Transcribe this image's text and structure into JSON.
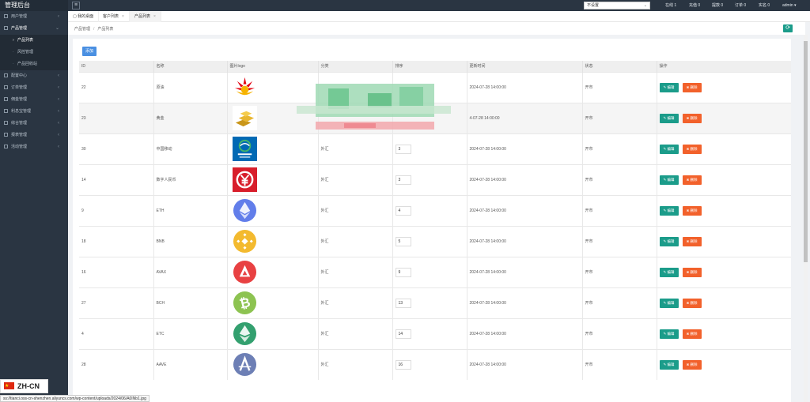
{
  "brand": "管理后台",
  "sidebar": {
    "items": [
      {
        "label": "用户管理",
        "chevron": "‹",
        "open": false
      },
      {
        "label": "产品管理",
        "chevron": "⌄",
        "open": true
      },
      {
        "label": "产品列表",
        "sub": true,
        "active": true
      },
      {
        "label": "风控管理",
        "sub": true
      },
      {
        "label": "产品回收站",
        "sub": true
      },
      {
        "label": "配置中心",
        "chevron": "‹"
      },
      {
        "label": "订单管理",
        "chevron": "‹"
      },
      {
        "label": "佣金管理",
        "chevron": "‹"
      },
      {
        "label": "利息宝管理",
        "chevron": "‹"
      },
      {
        "label": "综合管理",
        "chevron": "‹"
      },
      {
        "label": "报表管理",
        "chevron": "‹"
      },
      {
        "label": "活动管理",
        "chevron": "‹"
      }
    ]
  },
  "topbar": {
    "menu_icon": "≡",
    "select_value": "不设置",
    "stats": [
      {
        "label": "在线 1"
      },
      {
        "label": "充值 0"
      },
      {
        "label": "提款 0"
      },
      {
        "label": "订单 0"
      },
      {
        "label": "实名 0"
      },
      {
        "label": "admin ▾"
      }
    ]
  },
  "tabs": [
    {
      "label": "我的桌面",
      "icon": "▢",
      "closable": false
    },
    {
      "label": "客户列表",
      "closable": true
    },
    {
      "label": "产品列表",
      "closable": true,
      "active": true
    }
  ],
  "breadcrumb": {
    "items": [
      "产品管理",
      "产品列表"
    ],
    "separator": "/"
  },
  "refresh_icon": "⟳",
  "add_button": "添加",
  "table": {
    "headers": [
      "ID",
      "名称",
      "图片logo",
      "分类",
      "排序",
      "更新时间",
      "状态",
      "操作"
    ],
    "rows": [
      {
        "id": "22",
        "name": "原油",
        "logo": "oil",
        "category": "",
        "sort": "",
        "time": "2024-07-28 14:00:00",
        "status": "开市"
      },
      {
        "id": "23",
        "name": "黄金",
        "logo": "gold",
        "category": "",
        "sort": "",
        "time": "4-07-28 14:00:00",
        "status": "开市"
      },
      {
        "id": "30",
        "name": "中国移动",
        "logo": "mobile",
        "category": "外汇",
        "sort": "3",
        "time": "2024-07-28 14:00:00",
        "status": "开市"
      },
      {
        "id": "14",
        "name": "数字人民币",
        "logo": "ecny",
        "category": "外汇",
        "sort": "3",
        "time": "2024-07-28 14:00:00",
        "status": "开市"
      },
      {
        "id": "9",
        "name": "ETH",
        "logo": "eth",
        "category": "外汇",
        "sort": "4",
        "time": "2024-07-28 14:00:00",
        "status": "开市"
      },
      {
        "id": "18",
        "name": "BNB",
        "logo": "bnb",
        "category": "外汇",
        "sort": "5",
        "time": "2024-07-28 14:00:00",
        "status": "开市"
      },
      {
        "id": "16",
        "name": "AVAX",
        "logo": "avax",
        "category": "外汇",
        "sort": "9",
        "time": "2024-07-28 14:00:00",
        "status": "开市"
      },
      {
        "id": "27",
        "name": "BCH",
        "logo": "bch",
        "category": "外汇",
        "sort": "13",
        "time": "2024-07-28 14:00:00",
        "status": "开市"
      },
      {
        "id": "4",
        "name": "ETC",
        "logo": "etc",
        "category": "外汇",
        "sort": "14",
        "time": "2024-07-28 14:00:00",
        "status": "开市"
      },
      {
        "id": "28",
        "name": "AAVE",
        "logo": "aave",
        "category": "外汇",
        "sort": "16",
        "time": "2024-07-28 14:00:00",
        "status": "开市"
      }
    ],
    "edit_label": "✎ 编辑",
    "delete_label": "⊗ 删除"
  },
  "language": "ZH-CN",
  "status_url": "ss://tianci.oss-cn-shenzhen.aliyuncs.com/wp-content/uploads/2024/06/A0INb1.jpg",
  "colors": {
    "sidebar": "#2a3542",
    "edit": "#1b9c8a",
    "delete": "#f2612b",
    "add": "#4a90e2"
  }
}
